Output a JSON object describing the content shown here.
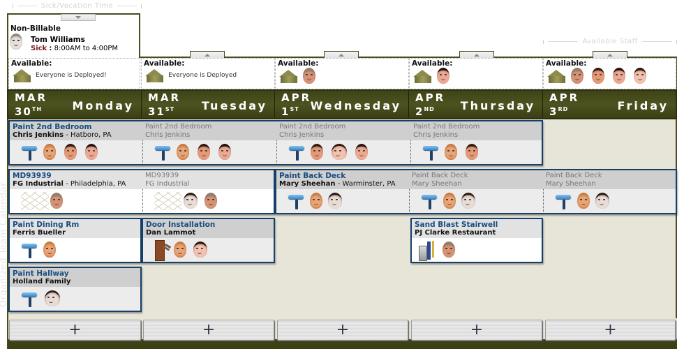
{
  "app": {
    "side_label": "Organized Team Calendar"
  },
  "sick_section": {
    "label": "Sick/Vacation Time",
    "heading": "Non-Billable",
    "person": "Tom Williams",
    "status": "Sick",
    "separator": ":",
    "time": "8:00AM to 4:00PM"
  },
  "available_section": {
    "label": "Available Staff"
  },
  "availability": [
    {
      "label": "Available:",
      "text": "Everyone is Deployed!",
      "faces": []
    },
    {
      "label": "Available:",
      "text": "Everyone is Deployed",
      "faces": []
    },
    {
      "label": "Available:",
      "text": "",
      "faces": [
        "grey-mustache"
      ]
    },
    {
      "label": "Available:",
      "text": "",
      "faces": [
        "dark-hair"
      ]
    },
    {
      "label": "Available:",
      "text": "",
      "faces": [
        "grey-mustache",
        "young-smile",
        "dark-hair",
        "dark-hair-beard"
      ]
    }
  ],
  "days": [
    {
      "month": "MAR",
      "day": "30",
      "suffix": "TH",
      "name": "Monday"
    },
    {
      "month": "MAR",
      "day": "31",
      "suffix": "ST",
      "name": "Tuesday"
    },
    {
      "month": "APR",
      "day": "1",
      "suffix": "ST",
      "name": "Wednesday"
    },
    {
      "month": "APR",
      "day": "2",
      "suffix": "ND",
      "name": "Thursday"
    },
    {
      "month": "APR",
      "day": "3",
      "suffix": "RD",
      "name": "Friday"
    }
  ],
  "jobs": [
    {
      "title": "Paint 2nd Bedroom",
      "client": "Chris Jenkins",
      "location": " - Hatboro, PA",
      "tool": "paint-roller",
      "segments": [
        [
          "blond",
          "young",
          "dark"
        ],
        [
          "blond",
          "young",
          "dark"
        ],
        [
          "young",
          "dark-beard",
          "dark"
        ],
        [
          "blond",
          "young"
        ]
      ]
    },
    {
      "title": "MD93939",
      "client": "FG Industrial",
      "location": " - Philadelphia, PA",
      "tool": "grid-layout",
      "segments": [
        [
          "grey"
        ],
        [
          "bw-mustache",
          "grey"
        ]
      ]
    },
    {
      "title": "Paint Back Deck",
      "client": "Mary Sheehan",
      "location": " - Warminster, PA",
      "tool": "paint-roller",
      "segments": [
        [
          "blond",
          "bw-mustache"
        ],
        [
          "blond",
          "bw-mustache"
        ],
        [
          "blond",
          "bw-mustache"
        ]
      ]
    },
    {
      "title": "Paint Dining Rm",
      "client": "Ferris Bueller",
      "location": "",
      "tool": "paint-roller",
      "segments": [
        [
          "blond"
        ]
      ]
    },
    {
      "title": "Door Installation",
      "client": "Dan Lammot",
      "location": "",
      "tool": "door-hammer",
      "segments": [
        [
          "blond",
          "dark-beard"
        ]
      ]
    },
    {
      "title": "Sand Blast Stairwell",
      "client": "PJ Clarke Restaurant",
      "location": "",
      "tool": "sand-blaster",
      "segments": [
        [
          "grey"
        ]
      ]
    },
    {
      "title": "Paint Hallway",
      "client": "Holland Family",
      "location": "",
      "tool": "paint-roller",
      "segments": [
        [
          "bw-mustache"
        ]
      ]
    }
  ],
  "add_button": {
    "label": "+"
  }
}
